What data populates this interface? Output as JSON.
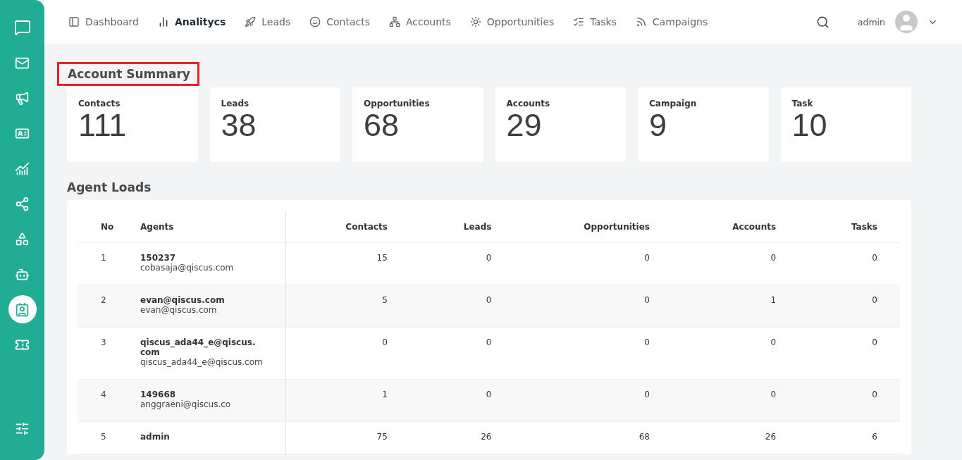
{
  "sidebar": {
    "items": [
      {
        "kind": "logo",
        "selected": false
      },
      {
        "kind": "mail",
        "selected": false
      },
      {
        "kind": "megaphone",
        "selected": false
      },
      {
        "kind": "card",
        "selected": false
      },
      {
        "kind": "chart",
        "selected": false
      },
      {
        "kind": "share",
        "selected": false
      },
      {
        "kind": "grid",
        "selected": false
      },
      {
        "kind": "bot",
        "selected": false
      },
      {
        "kind": "contact",
        "selected": true
      },
      {
        "kind": "ticket",
        "selected": false
      }
    ],
    "bottom": {
      "kind": "sliders",
      "selected": false
    }
  },
  "nav": [
    {
      "label": "Dashboard",
      "selected": false
    },
    {
      "label": "Analitycs",
      "selected": true
    },
    {
      "label": "Leads",
      "selected": false
    },
    {
      "label": "Contacts",
      "selected": false
    },
    {
      "label": "Accounts",
      "selected": false
    },
    {
      "label": "Opportunities",
      "selected": false
    },
    {
      "label": "Tasks",
      "selected": false
    },
    {
      "label": "Campaigns",
      "selected": false
    }
  ],
  "user": {
    "name": "admin"
  },
  "summary": {
    "title": "Account Summary",
    "highlighted": true,
    "cards": [
      {
        "label": "Contacts",
        "value": "111"
      },
      {
        "label": "Leads",
        "value": "38"
      },
      {
        "label": "Opportunities",
        "value": "68"
      },
      {
        "label": "Accounts",
        "value": "29"
      },
      {
        "label": "Campaign",
        "value": "9"
      },
      {
        "label": "Task",
        "value": "10"
      }
    ]
  },
  "agent_loads": {
    "title": "Agent Loads",
    "columns": [
      "No",
      "Agents",
      "Contacts",
      "Leads",
      "Opportunities",
      "Accounts",
      "Tasks"
    ],
    "rows": [
      {
        "no": "1",
        "agent": "150237",
        "email": "cobasaja@qiscus.com",
        "values": [
          "15",
          "0",
          "0",
          "0",
          "0"
        ]
      },
      {
        "no": "2",
        "agent": "evan@qiscus.com",
        "email": "evan@qiscus.com",
        "values": [
          "5",
          "0",
          "0",
          "1",
          "0"
        ]
      },
      {
        "no": "3",
        "agent": "qiscus_ada44_e@qiscus.com",
        "email": "qiscus_ada44_e@qiscus.com",
        "values": [
          "0",
          "0",
          "0",
          "0",
          "0"
        ]
      },
      {
        "no": "4",
        "agent": "149668",
        "email": "anggraeni@qiscus.co",
        "values": [
          "1",
          "0",
          "0",
          "0",
          "0"
        ]
      },
      {
        "no": "5",
        "agent": "admin",
        "values": [
          "75",
          "26",
          "68",
          "26",
          "6"
        ]
      }
    ]
  }
}
